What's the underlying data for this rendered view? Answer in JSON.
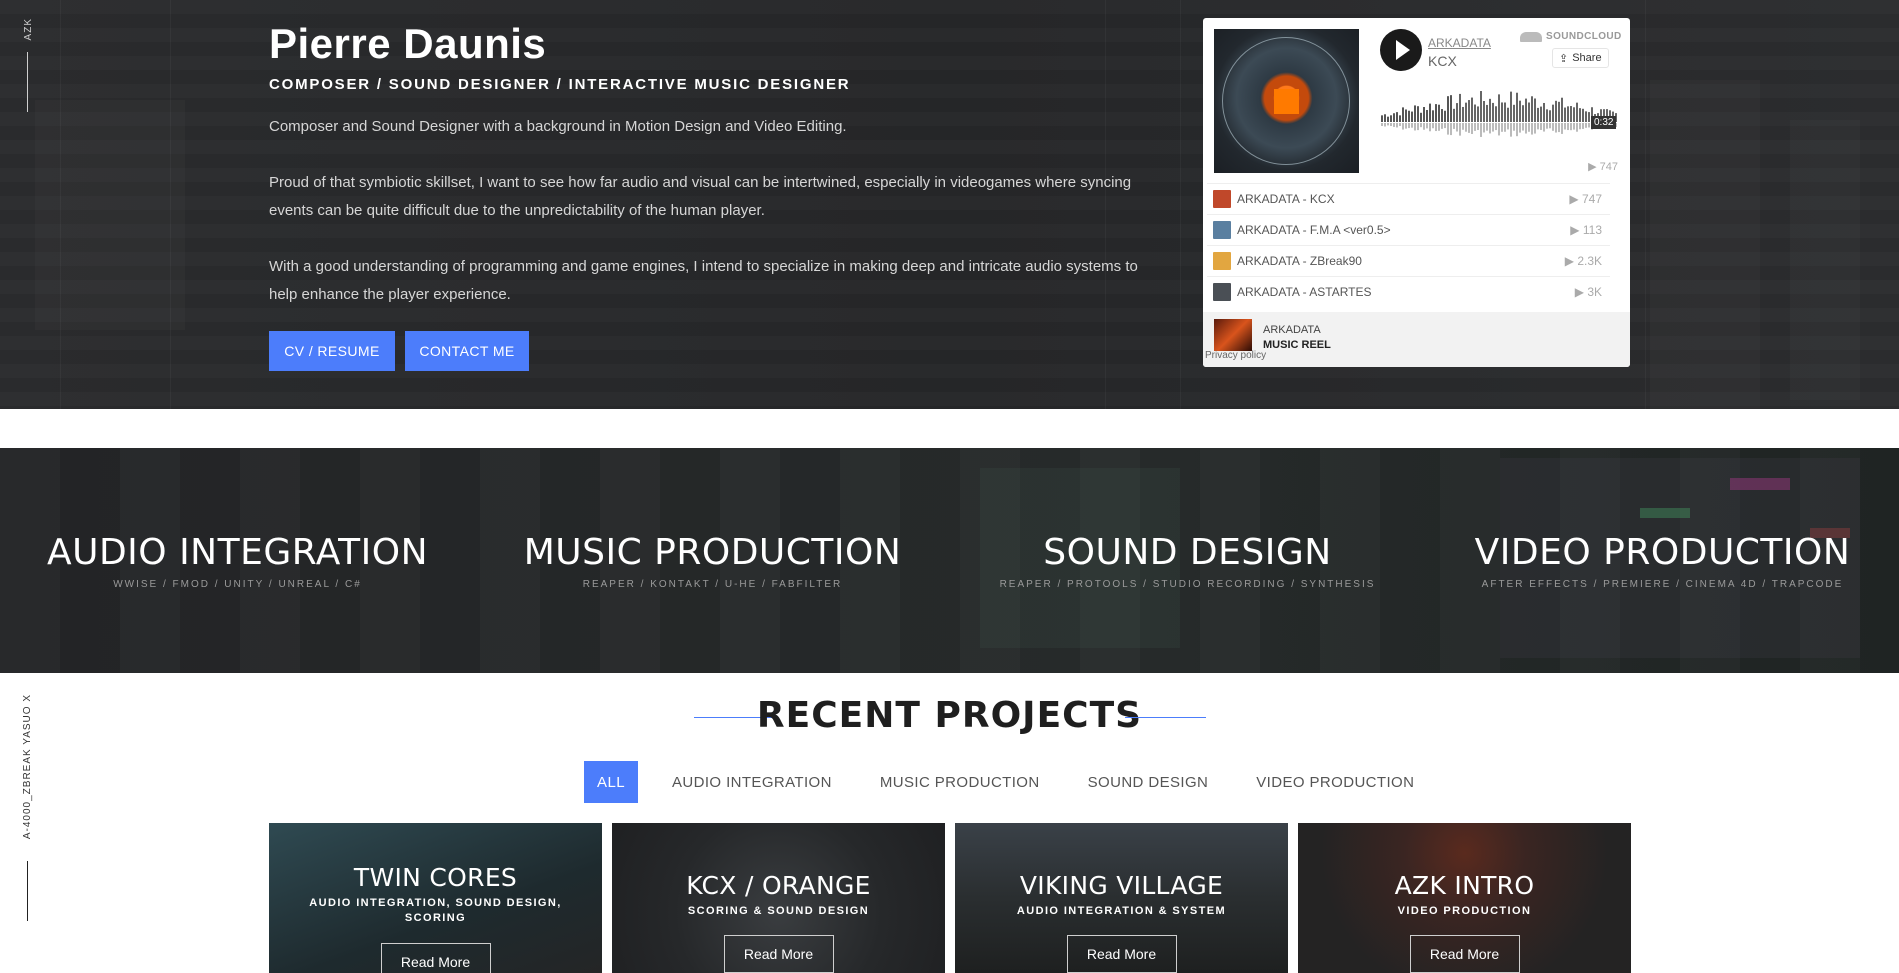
{
  "side": {
    "top_label": "AZK",
    "bottom_label": "A-4000_ZBREAK YASUO X"
  },
  "hero": {
    "name": "Pierre Daunis",
    "role": "COMPOSER / SOUND DESIGNER / INTERACTIVE MUSIC DESIGNER",
    "paragraphs": [
      "Composer and Sound Designer with a background in Motion Design and Video Editing.",
      "Proud of that symbiotic skillset, I want to see how far audio and visual can be intertwined, especially in videogames where syncing events can be quite difficult due to the unpredictability of the human player.",
      "With a good understanding of programming and game engines, I intend to specialize in making deep and intricate audio systems to help enhance the player experience."
    ],
    "cv_label": "CV / RESUME",
    "contact_label": "CONTACT ME"
  },
  "soundcloud": {
    "artist": "ARKADATA",
    "track": "KCX",
    "brand": "SOUNDCLOUD",
    "share": "Share",
    "time": "0:32",
    "plays": "▶ 747",
    "tracks": [
      {
        "title": "ARKADATA - KCX",
        "plays": "▶ 747",
        "color": "#c0482a"
      },
      {
        "title": "ARKADATA - F.M.A <ver0.5>",
        "plays": "▶ 113",
        "color": "#5a7fa0"
      },
      {
        "title": "ARKADATA - ZBreak90",
        "plays": "▶ 2.3K",
        "color": "#e2a640"
      },
      {
        "title": "ARKADATA - ASTARTES",
        "plays": "▶ 3K",
        "color": "#4a4f55"
      }
    ],
    "footer_artist": "ARKADATA",
    "footer_playlist": "MUSIC REEL",
    "privacy": "Privacy policy"
  },
  "services": [
    {
      "title": "AUDIO INTEGRATION",
      "tools": "WWISE / FMOD / UNITY / UNREAL / C#"
    },
    {
      "title": "MUSIC PRODUCTION",
      "tools": "REAPER / KONTAKT / U-HE / FABFILTER"
    },
    {
      "title": "SOUND DESIGN",
      "tools": "REAPER / PROTOOLS / STUDIO RECORDING / SYNTHESIS"
    },
    {
      "title": "VIDEO PRODUCTION",
      "tools": "AFTER EFFECTS / PREMIERE / CINEMA 4D / TRAPCODE"
    }
  ],
  "projects": {
    "heading": "RECENT PROJECTS",
    "filters": [
      "ALL",
      "AUDIO INTEGRATION",
      "MUSIC PRODUCTION",
      "SOUND DESIGN",
      "VIDEO PRODUCTION"
    ],
    "read_more": "Read More",
    "cards": [
      {
        "title": "TWIN CORES",
        "subtitle": "AUDIO INTEGRATION, SOUND DESIGN, SCORING"
      },
      {
        "title": "KCX / ORANGE",
        "subtitle": "SCORING & SOUND DESIGN"
      },
      {
        "title": "VIKING VILLAGE",
        "subtitle": "AUDIO INTEGRATION & SYSTEM"
      },
      {
        "title": "AZK INTRO",
        "subtitle": "VIDEO PRODUCTION"
      }
    ]
  },
  "colors": {
    "accent": "#4c7dfb",
    "hero_bg": "#28292b",
    "strip_bg": "#242526"
  }
}
